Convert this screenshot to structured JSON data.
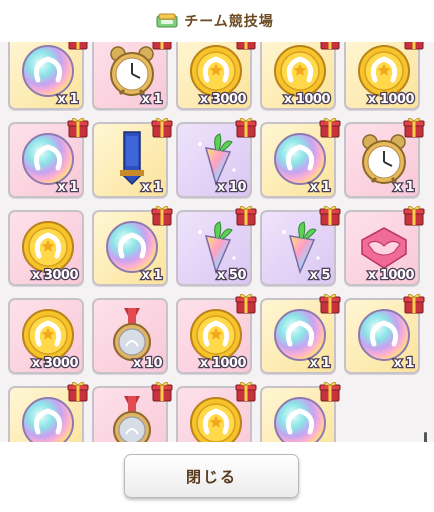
{
  "header": {
    "title": "チーム競技場",
    "icon": "ticket-icon"
  },
  "colors": {
    "title": "#6b4b22",
    "qty_stroke": "#4a3d55",
    "gift": "#c8323c"
  },
  "grid": {
    "columns": 5,
    "items": [
      {
        "item": "rainbow-horseshoe",
        "bg": "gold",
        "qty": "x 1",
        "gift": true
      },
      {
        "item": "alarm-clock",
        "bg": "pink",
        "qty": "x 1",
        "gift": true
      },
      {
        "item": "gold-horseshoe-coin",
        "bg": "gold",
        "qty": "x 3000",
        "gift": true
      },
      {
        "item": "gold-horseshoe-coin",
        "bg": "gold",
        "qty": "x 1000",
        "gift": true
      },
      {
        "item": "gold-horseshoe-coin",
        "bg": "gold",
        "qty": "x 1000",
        "gift": true
      },
      {
        "item": "rainbow-horseshoe",
        "bg": "pink",
        "qty": "x 1",
        "gift": true
      },
      {
        "item": "blue-ribbon",
        "bg": "gold",
        "qty": "x 1",
        "gift": true
      },
      {
        "item": "rainbow-carrot",
        "bg": "purple",
        "qty": "x 10",
        "gift": true
      },
      {
        "item": "rainbow-horseshoe",
        "bg": "gold",
        "qty": "x 1",
        "gift": true
      },
      {
        "item": "alarm-clock",
        "bg": "pink",
        "qty": "x 1",
        "gift": true
      },
      {
        "item": "gold-horseshoe-coin",
        "bg": "pink",
        "qty": "x 3000",
        "gift": false
      },
      {
        "item": "rainbow-horseshoe",
        "bg": "gold",
        "qty": "x 1",
        "gift": true
      },
      {
        "item": "rainbow-carrot",
        "bg": "purple",
        "qty": "x 50",
        "gift": true
      },
      {
        "item": "rainbow-carrot",
        "bg": "purple",
        "qty": "x 5",
        "gift": true
      },
      {
        "item": "handshake-ticket",
        "bg": "pink",
        "qty": "x 1000",
        "gift": true
      },
      {
        "item": "gold-horseshoe-coin",
        "bg": "pink",
        "qty": "x 3000",
        "gift": false
      },
      {
        "item": "silver-medal",
        "bg": "pink",
        "qty": "x 10",
        "gift": false
      },
      {
        "item": "gold-horseshoe-coin",
        "bg": "pink",
        "qty": "x 1000",
        "gift": true
      },
      {
        "item": "rainbow-horseshoe",
        "bg": "gold",
        "qty": "x 1",
        "gift": true
      },
      {
        "item": "rainbow-horseshoe",
        "bg": "gold",
        "qty": "x 1",
        "gift": true
      },
      {
        "item": "rainbow-horseshoe",
        "bg": "gold",
        "qty": "",
        "gift": true
      },
      {
        "item": "silver-medal",
        "bg": "pink",
        "qty": "",
        "gift": true
      },
      {
        "item": "gold-horseshoe-coin",
        "bg": "pink",
        "qty": "",
        "gift": true
      },
      {
        "item": "rainbow-horseshoe",
        "bg": "gold",
        "qty": "",
        "gift": true
      }
    ]
  },
  "footer": {
    "close_label": "閉じる"
  }
}
